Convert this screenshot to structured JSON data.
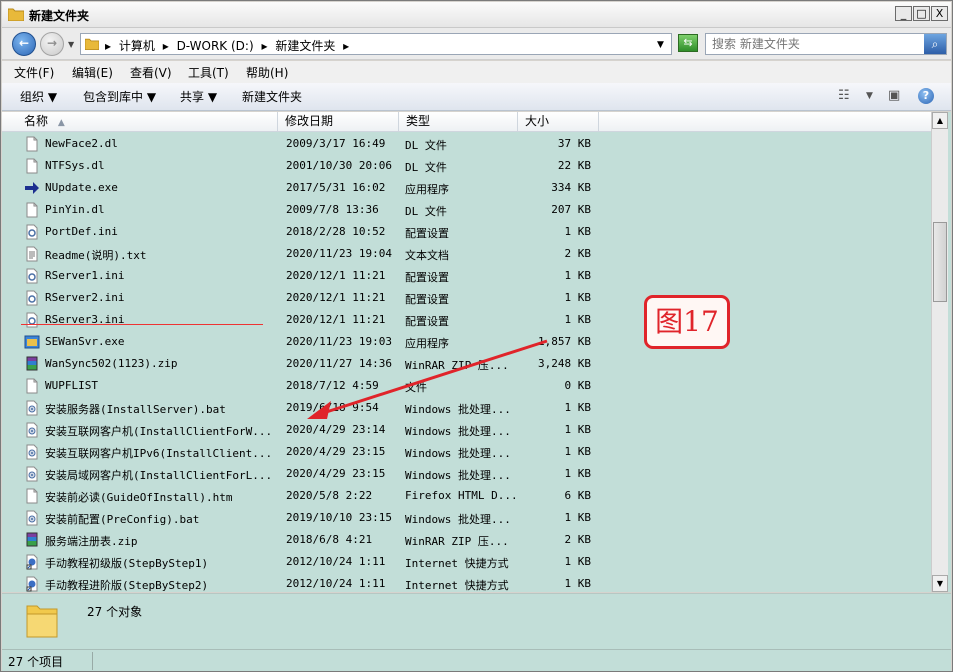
{
  "window": {
    "title": "新建文件夹"
  },
  "title_buttons": {
    "minimize": "_",
    "maximize": "□",
    "close": "X"
  },
  "address": {
    "crumbs": [
      "▸",
      "计算机",
      "▸",
      "D-WORK (D:)",
      "▸",
      "新建文件夹",
      "▸"
    ]
  },
  "search": {
    "placeholder": "搜索 新建文件夹"
  },
  "menu": [
    "文件(F)",
    "编辑(E)",
    "查看(V)",
    "工具(T)",
    "帮助(H)"
  ],
  "toolbar": {
    "organize": "组织 ▼",
    "include": "包含到库中 ▼",
    "share": "共享 ▼",
    "new_folder": "新建文件夹"
  },
  "columns": {
    "name": "名称",
    "date": "修改日期",
    "type": "类型",
    "size": "大小"
  },
  "files": [
    {
      "name": "NewFace2.dl",
      "date": "2009/3/17 16:49",
      "type": "DL 文件",
      "size": "37 KB",
      "icon": "blank-file-icon"
    },
    {
      "name": "NTFSys.dl",
      "date": "2001/10/30 20:06",
      "type": "DL 文件",
      "size": "22 KB",
      "icon": "blank-file-icon"
    },
    {
      "name": "NUpdate.exe",
      "date": "2017/5/31 16:02",
      "type": "应用程序",
      "size": "334 KB",
      "icon": "arrow-exe-icon"
    },
    {
      "name": "PinYin.dl",
      "date": "2009/7/8 13:36",
      "type": "DL 文件",
      "size": "207 KB",
      "icon": "blank-file-icon"
    },
    {
      "name": "PortDef.ini",
      "date": "2018/2/28 10:52",
      "type": "配置设置",
      "size": "1 KB",
      "icon": "ini-file-icon"
    },
    {
      "name": "Readme(说明).txt",
      "date": "2020/11/23 19:04",
      "type": "文本文档",
      "size": "2 KB",
      "icon": "text-file-icon"
    },
    {
      "name": "RServer1.ini",
      "date": "2020/12/1 11:21",
      "type": "配置设置",
      "size": "1 KB",
      "icon": "ini-file-icon"
    },
    {
      "name": "RServer2.ini",
      "date": "2020/12/1 11:21",
      "type": "配置设置",
      "size": "1 KB",
      "icon": "ini-file-icon"
    },
    {
      "name": "RServer3.ini",
      "date": "2020/12/1 11:21",
      "type": "配置设置",
      "size": "1 KB",
      "icon": "ini-file-icon"
    },
    {
      "name": "SEWanSvr.exe",
      "date": "2020/11/23 19:03",
      "type": "应用程序",
      "size": "1,857 KB",
      "icon": "app-exe-icon"
    },
    {
      "name": "WanSync502(1123).zip",
      "date": "2020/11/27 14:36",
      "type": "WinRAR ZIP 压...",
      "size": "3,248 KB",
      "icon": "winrar-icon"
    },
    {
      "name": "WUPFLIST",
      "date": "2018/7/12 4:59",
      "type": "文件",
      "size": "0 KB",
      "icon": "blank-file-icon"
    },
    {
      "name": "安装服务器(InstallServer).bat",
      "date": "2019/6/18 9:54",
      "type": "Windows 批处理...",
      "size": "1 KB",
      "icon": "bat-file-icon"
    },
    {
      "name": "安装互联网客户机(InstallClientForW...",
      "date": "2020/4/29 23:14",
      "type": "Windows 批处理...",
      "size": "1 KB",
      "icon": "bat-file-icon"
    },
    {
      "name": "安装互联网客户机IPv6(InstallClient...",
      "date": "2020/4/29 23:15",
      "type": "Windows 批处理...",
      "size": "1 KB",
      "icon": "bat-file-icon"
    },
    {
      "name": "安装局域网客户机(InstallClientForL...",
      "date": "2020/4/29 23:15",
      "type": "Windows 批处理...",
      "size": "1 KB",
      "icon": "bat-file-icon"
    },
    {
      "name": "安装前必读(GuideOfInstall).htm",
      "date": "2020/5/8 2:22",
      "type": "Firefox HTML D...",
      "size": "6 KB",
      "icon": "blank-file-icon"
    },
    {
      "name": "安装前配置(PreConfig).bat",
      "date": "2019/10/10 23:15",
      "type": "Windows 批处理...",
      "size": "1 KB",
      "icon": "bat-file-icon"
    },
    {
      "name": "服务端注册表.zip",
      "date": "2018/6/8 4:21",
      "type": "WinRAR ZIP 压...",
      "size": "2 KB",
      "icon": "winrar-icon"
    },
    {
      "name": "手动教程初级版(StepByStep1)",
      "date": "2012/10/24 1:11",
      "type": "Internet 快捷方式",
      "size": "1 KB",
      "icon": "shortcut-icon"
    },
    {
      "name": "手动教程进阶版(StepByStep2)",
      "date": "2012/10/24 1:11",
      "type": "Internet 快捷方式",
      "size": "1 KB",
      "icon": "shortcut-icon"
    }
  ],
  "details": {
    "count": "27 个对象"
  },
  "status": {
    "text": "27 个项目"
  },
  "annotation": {
    "label": "图17",
    "color": "#e0242a"
  }
}
